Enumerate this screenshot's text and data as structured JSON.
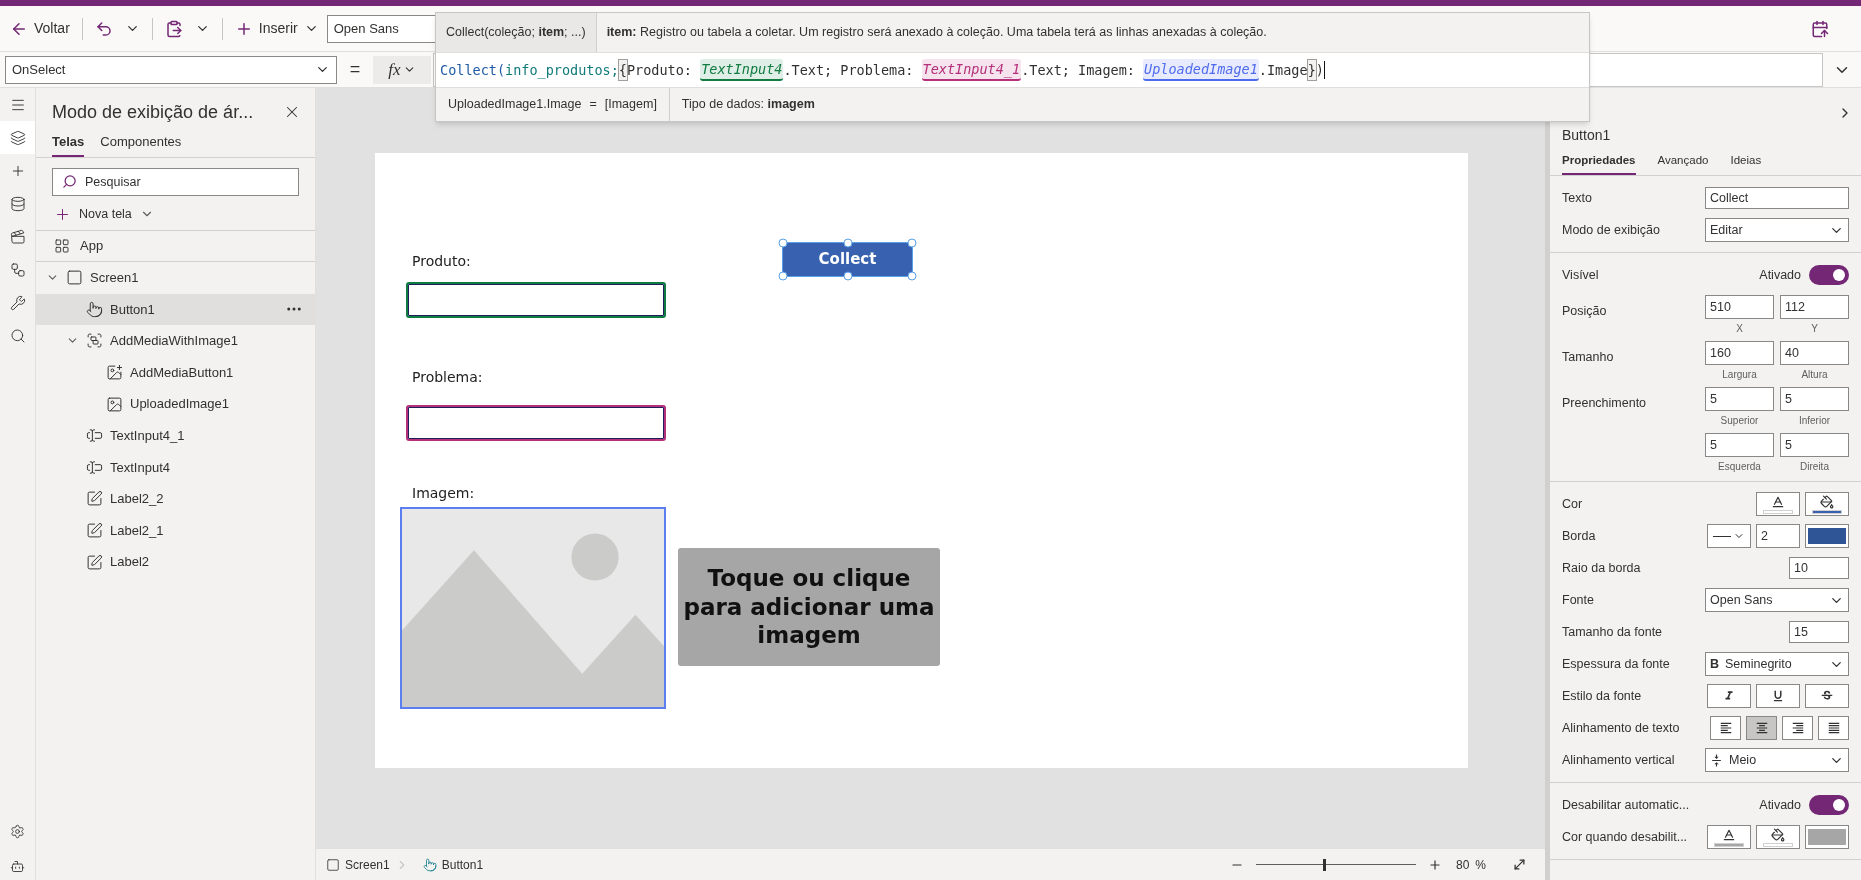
{
  "toolbar": {
    "back": "Voltar",
    "insert": "Inserir",
    "font": "Open Sans"
  },
  "formula_bar": {
    "property": "OnSelect",
    "equals": "=",
    "fx": "fx"
  },
  "intellisense": {
    "signature": "Collect(coleção; **item**; ...)",
    "description": "**item:** Registro ou tabela a coletar. Um registro será anexado à coleção. Uma tabela terá as linhas anexadas à coleção.",
    "tokens": [
      {
        "kind": "function",
        "text": "Collect("
      },
      {
        "kind": "variable",
        "text": "info_produtos;"
      },
      {
        "kind": "bracket",
        "text": "{"
      },
      {
        "kind": "text",
        "text": "Produto: "
      },
      {
        "kind": "control",
        "text": "TextInput4",
        "color": "#107c41"
      },
      {
        "kind": "text",
        "text": ".Text; Problema: "
      },
      {
        "kind": "control",
        "text": "TextInput4_1",
        "color": "#b4307a"
      },
      {
        "kind": "text",
        "text": ".Text; Imagem: "
      },
      {
        "kind": "control",
        "text": "UploadedImage1",
        "color": "#4f6bed"
      },
      {
        "kind": "text",
        "text": ".Image"
      },
      {
        "kind": "bracket",
        "text": "}"
      },
      {
        "kind": "text",
        "text": ")"
      }
    ],
    "result_expression": "UploadedImage1.Image",
    "result_equals": "=",
    "result_value": "[Imagem]",
    "data_type": "Tipo de dados: **imagem**"
  },
  "rail": [
    {
      "kind": "menu",
      "selected": false
    },
    {
      "kind": "layers",
      "selected": true
    },
    {
      "kind": "insert",
      "selected": false
    },
    {
      "kind": "data",
      "selected": false
    },
    {
      "kind": "media",
      "selected": false
    },
    {
      "kind": "flow",
      "selected": false
    },
    {
      "kind": "tools",
      "selected": false
    },
    {
      "kind": "search",
      "selected": false
    }
  ],
  "rail_bottom": [
    {
      "kind": "settings"
    },
    {
      "kind": "bot"
    }
  ],
  "tree_panel": {
    "title": "Modo de exibição de ár...",
    "tabs": [
      {
        "label": "Telas",
        "selected": true
      },
      {
        "label": "Componentes",
        "selected": false
      }
    ],
    "search_placeholder": "Pesquisar",
    "new_screen": "Nova tela",
    "app": {
      "label": "App",
      "kind": "app"
    },
    "items": [
      {
        "label": "Screen1",
        "kind": "screen",
        "selected": false,
        "expanded": true,
        "children": [
          {
            "label": "Button1",
            "kind": "button",
            "selected": true
          },
          {
            "label": "AddMediaWithImage1",
            "kind": "group",
            "selected": false,
            "expanded": true,
            "children": [
              {
                "label": "AddMediaButton1",
                "kind": "addmedia",
                "selected": false
              },
              {
                "label": "UploadedImage1",
                "kind": "image",
                "selected": false
              }
            ]
          },
          {
            "label": "TextInput4_1",
            "kind": "textinput",
            "selected": false
          },
          {
            "label": "TextInput4",
            "kind": "textinput",
            "selected": false
          },
          {
            "label": "Label2_2",
            "kind": "label",
            "selected": false
          },
          {
            "label": "Label2_1",
            "kind": "label",
            "selected": false
          },
          {
            "label": "Label2",
            "kind": "label",
            "selected": false
          }
        ]
      }
    ]
  },
  "canvas": {
    "controls": [
      {
        "kind": "label",
        "text": "Produto:"
      },
      {
        "kind": "input",
        "color": "#107c41"
      },
      {
        "kind": "button",
        "text": "Collect",
        "selected": true
      },
      {
        "kind": "label",
        "text": "Problema:"
      },
      {
        "kind": "input",
        "color": "#b4307a"
      },
      {
        "kind": "label",
        "text": "Imagem:"
      },
      {
        "kind": "image",
        "selected": true
      },
      {
        "kind": "addmedia",
        "text": "Toque ou clique para adicionar uma imagem"
      }
    ]
  },
  "status_bar": {
    "breadcrumb": [
      "Screen1",
      "Button1"
    ],
    "zoom": {
      "level": 0.42,
      "value": "80",
      "unit": "%"
    }
  },
  "properties": {
    "control": "Button1",
    "tabs": [
      {
        "label": "Propriedades",
        "selected": true
      },
      {
        "label": "Avançado",
        "selected": false
      },
      {
        "label": "Ideias",
        "selected": false
      }
    ],
    "sections": [
      [
        {
          "kind": "text",
          "label": "Texto",
          "value": "Collect"
        },
        {
          "kind": "dropdown",
          "label": "Modo de exibição",
          "value": "Editar"
        }
      ],
      [
        {
          "kind": "toggle",
          "label": "Visível",
          "value": "Ativado",
          "on": true
        },
        {
          "kind": "pair",
          "label": "Posição",
          "fields": [
            {
              "value": "510",
              "caption": "X"
            },
            {
              "value": "112",
              "caption": "Y"
            }
          ]
        },
        {
          "kind": "pair",
          "label": "Tamanho",
          "fields": [
            {
              "value": "160",
              "caption": "Largura"
            },
            {
              "value": "40",
              "caption": "Altura"
            }
          ]
        },
        {
          "kind": "pair",
          "label": "Preenchimento",
          "fields": [
            {
              "value": "5",
              "caption": "Superior"
            },
            {
              "value": "5",
              "caption": "Inferior"
            }
          ]
        },
        {
          "kind": "pair",
          "fields": [
            {
              "value": "5",
              "caption": "Esquerda"
            },
            {
              "value": "5",
              "caption": "Direita"
            }
          ]
        }
      ],
      [
        {
          "kind": "colors",
          "label": "Cor",
          "swatches": [
            {
              "kind": "font_color",
              "color": "#ffffff"
            },
            {
              "kind": "fill",
              "color": "#3a5fb0"
            }
          ]
        },
        {
          "kind": "border",
          "label": "Borda",
          "value": "2",
          "color": "#2f5597"
        },
        {
          "kind": "number",
          "label": "Raio da borda",
          "value": "10"
        },
        {
          "kind": "dropdown",
          "label": "Fonte",
          "value": "Open Sans"
        },
        {
          "kind": "number",
          "label": "Tamanho da fonte",
          "value": "15"
        },
        {
          "kind": "dropdown",
          "label": "Espessura da fonte",
          "value": "Seminegrito",
          "prefix": "B"
        },
        {
          "kind": "styles",
          "label": "Estilo da fonte",
          "buttons": [
            {
              "kind": "italic",
              "selected": false
            },
            {
              "kind": "underline",
              "selected": false
            },
            {
              "kind": "strikethrough",
              "selected": false
            }
          ]
        },
        {
          "kind": "align",
          "label": "Alinhamento de texto",
          "buttons": [
            {
              "kind": "left",
              "selected": false
            },
            {
              "kind": "center",
              "selected": true
            },
            {
              "kind": "right",
              "selected": false
            },
            {
              "kind": "justify",
              "selected": false
            }
          ]
        },
        {
          "kind": "vertical_align",
          "label": "Alinhamento vertical",
          "value": "Meio"
        }
      ],
      [
        {
          "kind": "toggle",
          "label": "Desabilitar automatic...",
          "value": "Ativado",
          "on": true
        },
        {
          "kind": "colors",
          "label": "Cor quando desabilit...",
          "swatches": [
            {
              "kind": "font_color",
              "color": "#a6a6a6"
            },
            {
              "kind": "fill",
              "color": "#ffffff"
            },
            {
              "kind": "swatch",
              "color": "#a6a6a6"
            }
          ]
        }
      ]
    ]
  }
}
